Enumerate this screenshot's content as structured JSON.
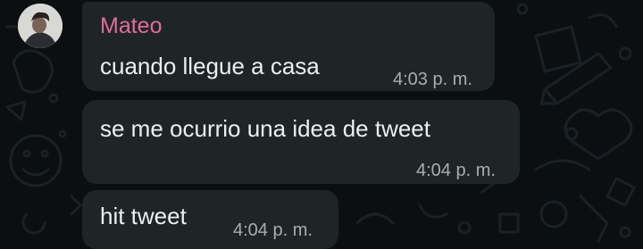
{
  "theme": {
    "background": "#0b0f12",
    "bubble": "#1f2527",
    "sender_color": "#e06c9c",
    "text_color": "#eceff0",
    "time_color": "#a7adb0"
  },
  "chat": {
    "sender": "Mateo",
    "messages": [
      {
        "text": "cuando llegue a casa",
        "time": "4:03 p. m."
      },
      {
        "text": "se me ocurrio una idea de tweet",
        "time": "4:04 p. m."
      },
      {
        "text": "hit tweet",
        "time": "4:04 p. m."
      }
    ]
  }
}
